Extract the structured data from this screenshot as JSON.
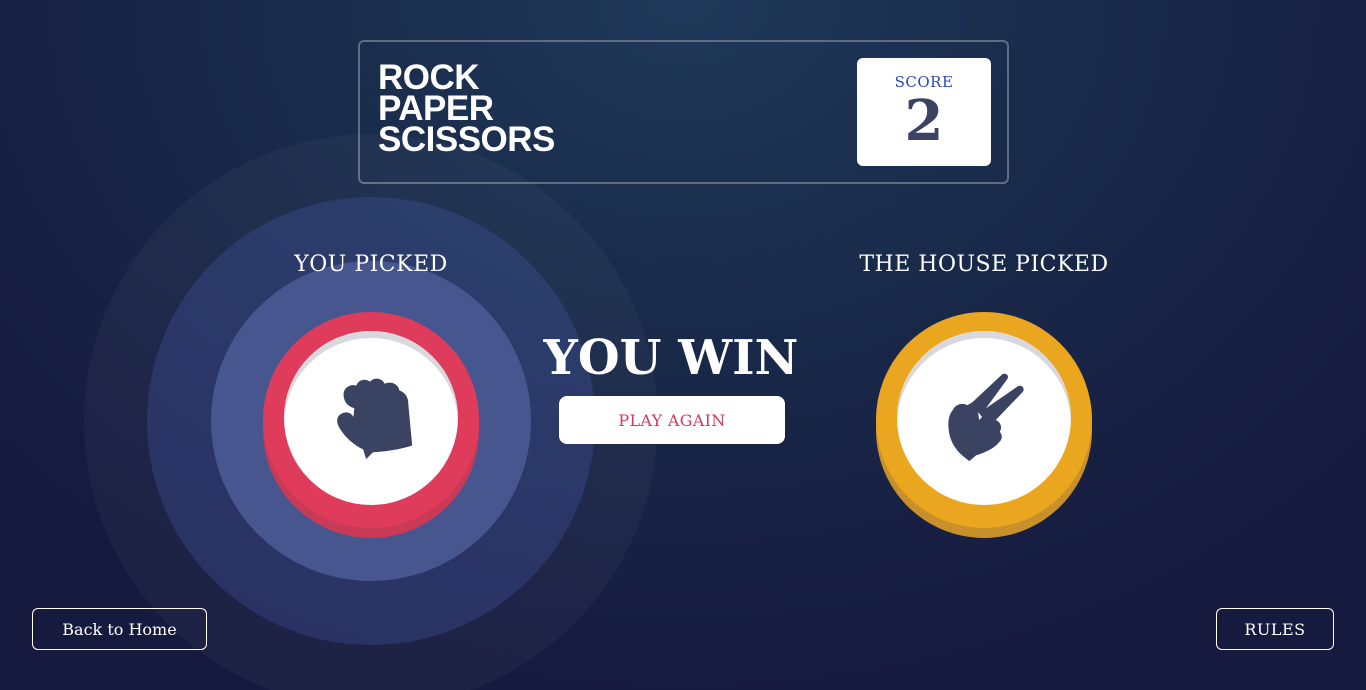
{
  "header": {
    "title_lines": [
      "ROCK",
      "PAPER",
      "SCISSORS"
    ],
    "score_label": "SCORE",
    "score_value": "2"
  },
  "game": {
    "you_picked_label": "YOU PICKED",
    "house_picked_label": "THE HOUSE PICKED",
    "player_choice": "rock",
    "house_choice": "scissors",
    "player_icon": "rock-fist-icon",
    "house_icon": "scissors-hand-icon",
    "result_text": "YOU WIN",
    "play_again_label": "PLAY AGAIN"
  },
  "footer": {
    "back_label": "Back to Home",
    "rules_label": "RULES"
  },
  "colors": {
    "rock": "#df3c5c",
    "scissors": "#eba61f",
    "score_label": "#2a46c0",
    "score_value": "#3b4363",
    "icon_fill": "#3b4363",
    "background": "#192a4a"
  }
}
